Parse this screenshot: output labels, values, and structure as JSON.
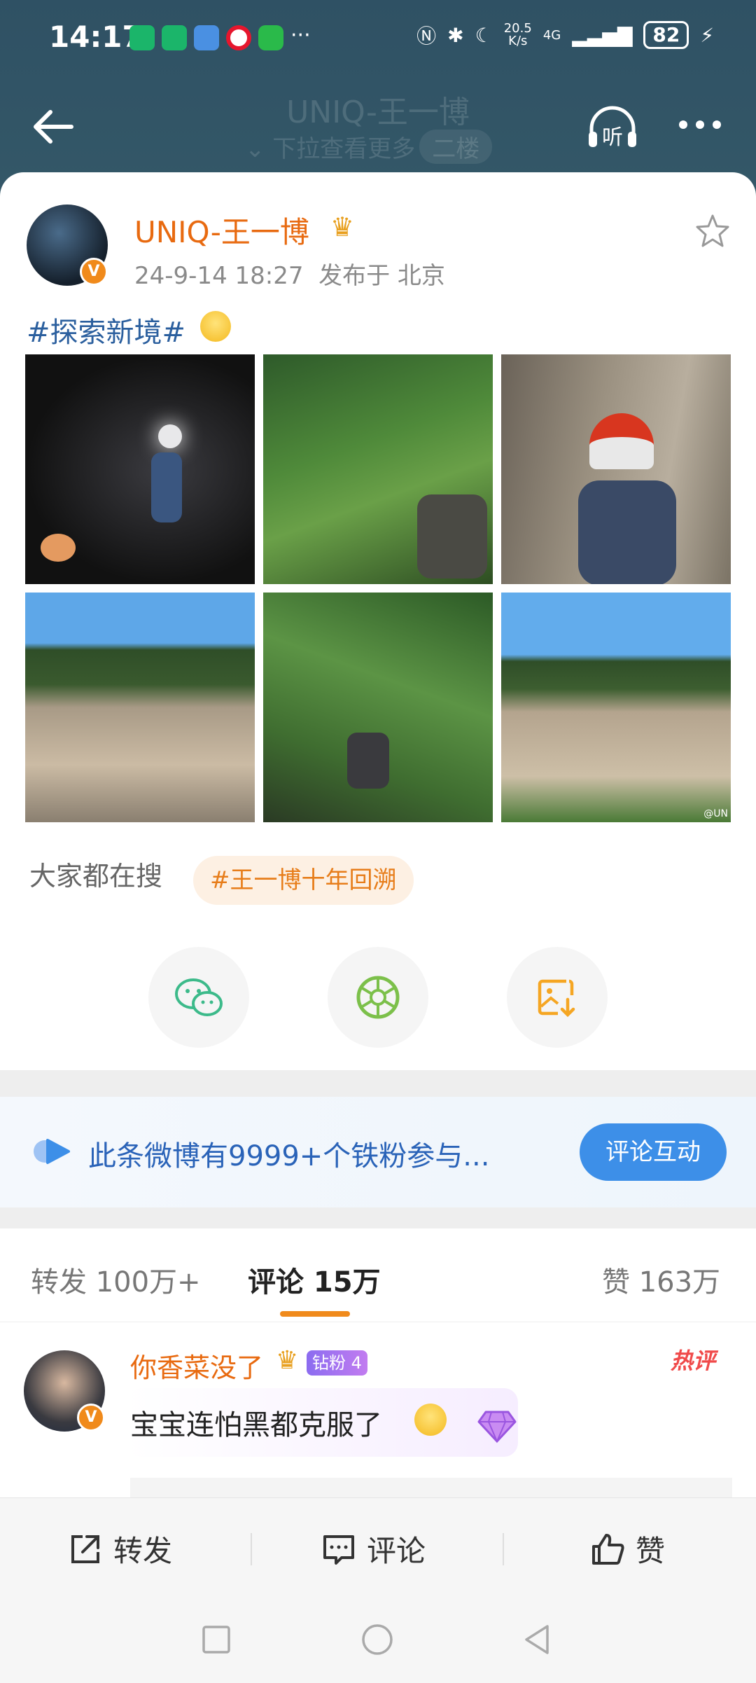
{
  "status_bar": {
    "time": "14:17",
    "net_speed": "20.5\nK/s",
    "signal": "4G",
    "battery": "82"
  },
  "nav": {
    "ghost_title": "UNIQ-王一博",
    "ghost_subtitle": "下拉查看更多",
    "ghost_tag": "二楼",
    "listen_label": "听"
  },
  "post": {
    "username": "UNIQ-王一博",
    "verified_mark": "V",
    "time": "24-9-14 18:27",
    "location": "发布于 北京",
    "hashtag": "#探索新境#",
    "photos": [
      "photo-1",
      "photo-2",
      "photo-3",
      "photo-4",
      "photo-5",
      "photo-6"
    ],
    "watermark": "@UN"
  },
  "search": {
    "label": "大家都在搜",
    "tag": "#王一博十年回溯"
  },
  "share_icons": [
    "wechat-icon",
    "moments-icon",
    "save-image-icon"
  ],
  "fans_banner": {
    "text": "此条微博有9999+个铁粉参与...",
    "button": "评论互动"
  },
  "tabs": {
    "repost": "转发 100万+",
    "comment": "评论 15万",
    "like": "赞 163万"
  },
  "comment": {
    "username": "你香菜没了",
    "fan_badge": "钻粉 4",
    "hot_label": "热评",
    "text": "宝宝连怕黑都克服了"
  },
  "actions": {
    "repost": "转发",
    "comment": "评论",
    "like": "赞"
  },
  "colors": {
    "header_bg": "#2f5164",
    "username": "#e86a10",
    "hashtag": "#2b5f9e",
    "accent_orange": "#f08a1b",
    "blue_button": "#3d8fe8"
  }
}
